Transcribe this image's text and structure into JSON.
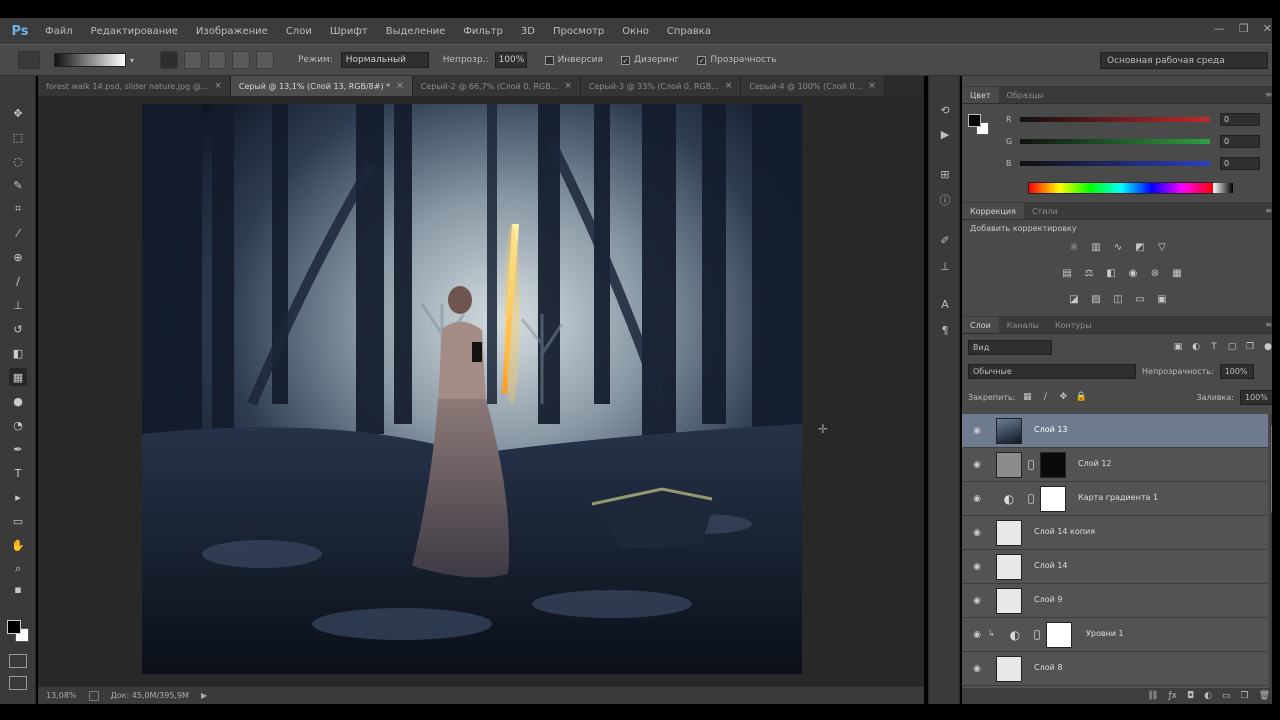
{
  "app": {
    "logo": "Ps",
    "window_buttons": [
      "—",
      "❐",
      "✕"
    ]
  },
  "menu": [
    "Файл",
    "Редактирование",
    "Изображение",
    "Слои",
    "Шрифт",
    "Выделение",
    "Фильтр",
    "3D",
    "Просмотр",
    "Окно",
    "Справка"
  ],
  "options": {
    "mode_label": "Режим:",
    "mode_value": "Нормальный",
    "opacity_label": "Непрозр.:",
    "opacity_value": "100%",
    "checks": [
      {
        "label": "Инверсия",
        "checked": false
      },
      {
        "label": "Дизеринг",
        "checked": true
      },
      {
        "label": "Прозрачность",
        "checked": true
      }
    ],
    "workspace": "Основная рабочая среда"
  },
  "tabs": [
    {
      "label": "forest walk 14.psd, slider nature.jpg @...",
      "active": false
    },
    {
      "label": "Серый @ 13,1% (Слой 13, RGB/8#) *",
      "active": true
    },
    {
      "label": "Серый-2 @ 66,7% (Слой 0, RGB...",
      "active": false
    },
    {
      "label": "Серый-3 @ 33% (Слой 0, RGB...",
      "active": false
    },
    {
      "label": "Серый-4 @ 100% (Слой 0...",
      "active": false
    }
  ],
  "status": {
    "zoom": "13,08%",
    "doc": "Док: 45,0M/395,9M"
  },
  "color_panel": {
    "tabs": [
      "Цвет",
      "Образцы"
    ],
    "sliders": [
      {
        "label": "R",
        "value": "0",
        "color": "#c0292b"
      },
      {
        "label": "G",
        "value": "0",
        "color": "#2ea043"
      },
      {
        "label": "B",
        "value": "0",
        "color": "#2b3fbf"
      }
    ]
  },
  "adjustments_panel": {
    "tabs": [
      "Коррекция",
      "Стили"
    ],
    "heading": "Добавить корректировку"
  },
  "layers_panel": {
    "tabs": [
      "Слои",
      "Каналы",
      "Контуры"
    ],
    "filter": "Вид",
    "blend": "Обычные",
    "opacity_label": "Непрозрачность:",
    "opacity": "100%",
    "lock_label": "Закрепить:",
    "fill_label": "Заливка:",
    "fill": "100%",
    "layers": [
      {
        "name": "Слой 13",
        "selected": true,
        "thumb": "dark-photo",
        "mask": false,
        "indent": 0
      },
      {
        "name": "Слой 12",
        "selected": false,
        "thumb": "gray",
        "mask": "black",
        "indent": 0
      },
      {
        "name": "Карта градиента 1",
        "selected": false,
        "thumb": "adjust",
        "mask": "white",
        "indent": 0
      },
      {
        "name": "Слой 14 копия",
        "selected": false,
        "thumb": "light",
        "mask": false,
        "indent": 0
      },
      {
        "name": "Слой 14",
        "selected": false,
        "thumb": "light",
        "mask": false,
        "indent": 0
      },
      {
        "name": "Слой 9",
        "selected": false,
        "thumb": "light",
        "mask": false,
        "indent": 0
      },
      {
        "name": "Уровни 1",
        "selected": false,
        "thumb": "adjust",
        "mask": "white",
        "indent": 1
      },
      {
        "name": "Слой 8",
        "selected": false,
        "thumb": "light",
        "mask": false,
        "indent": 0
      }
    ]
  }
}
